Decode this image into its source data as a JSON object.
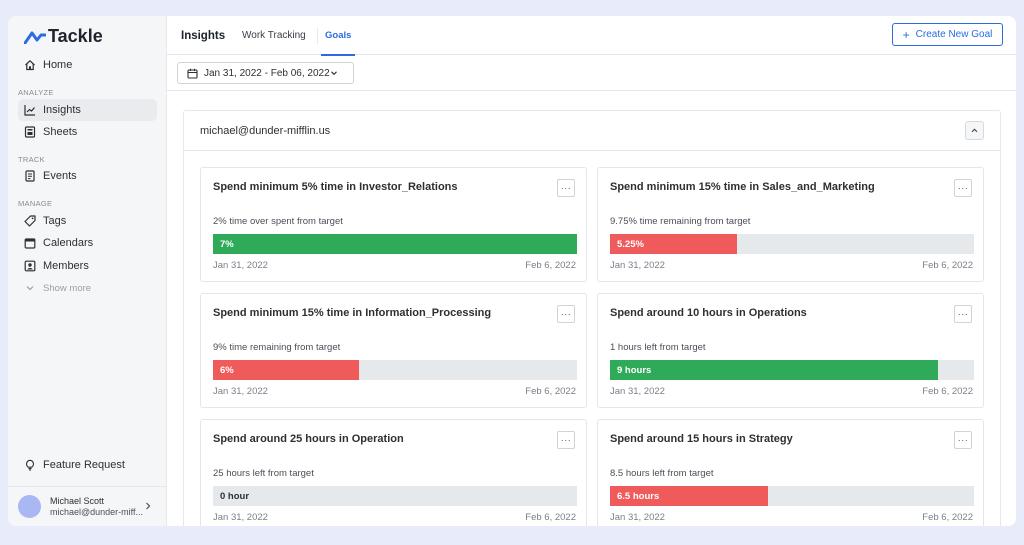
{
  "app": {
    "name": "Tackle",
    "brand_color": "#2b6ce2"
  },
  "sidebar": {
    "home": "Home",
    "sections": {
      "analyze": "ANALYZE",
      "track": "TRACK",
      "manage": "MANAGE"
    },
    "items": {
      "insights": "Insights",
      "sheets": "Sheets",
      "events": "Events",
      "tags": "Tags",
      "calendars": "Calendars",
      "members": "Members",
      "show_more": "Show more"
    },
    "feature_request": "Feature Request",
    "profile": {
      "name": "Michael Scott",
      "email": "michael@dunder-miff..."
    }
  },
  "header": {
    "title": "Insights",
    "tabs": [
      "Work Tracking",
      "Goals"
    ],
    "active_tab": "Goals",
    "create_button": "Create New Goal"
  },
  "date_range": "Jan 31, 2022 - Feb 06, 2022",
  "panel": {
    "email": "michael@dunder-mifflin.us",
    "menu_glyph": "···",
    "goals": [
      {
        "title": "Spend minimum 5% time in Investor_Relations",
        "subtitle": "2% time over spent from target",
        "value_label": "7%",
        "progress": 1.0,
        "status": "green",
        "start": "Jan 31, 2022",
        "end": "Feb 6, 2022"
      },
      {
        "title": "Spend minimum 15% time in Sales_and_Marketing",
        "subtitle": "9.75% time remaining from target",
        "value_label": "5.25%",
        "progress": 0.35,
        "status": "red",
        "start": "Jan 31, 2022",
        "end": "Feb 6, 2022"
      },
      {
        "title": "Spend minimum 15% time in Information_Processing",
        "subtitle": "9% time remaining from target",
        "value_label": "6%",
        "progress": 0.4,
        "status": "red",
        "start": "Jan 31, 2022",
        "end": "Feb 6, 2022"
      },
      {
        "title": "Spend around 10 hours in Operations",
        "subtitle": "1 hours left from target",
        "value_label": "9 hours",
        "progress": 0.9,
        "status": "green",
        "start": "Jan 31, 2022",
        "end": "Feb 6, 2022"
      },
      {
        "title": "Spend around 25 hours in Operation",
        "subtitle": "25 hours left from target",
        "value_label": "0 hour",
        "progress": 0,
        "status": "empty",
        "start": "Jan 31, 2022",
        "end": "Feb 6, 2022"
      },
      {
        "title": "Spend around 15 hours in Strategy",
        "subtitle": "8.5 hours left from target",
        "value_label": "6.5 hours",
        "progress": 0.433,
        "status": "red",
        "start": "Jan 31, 2022",
        "end": "Feb 6, 2022"
      }
    ]
  }
}
